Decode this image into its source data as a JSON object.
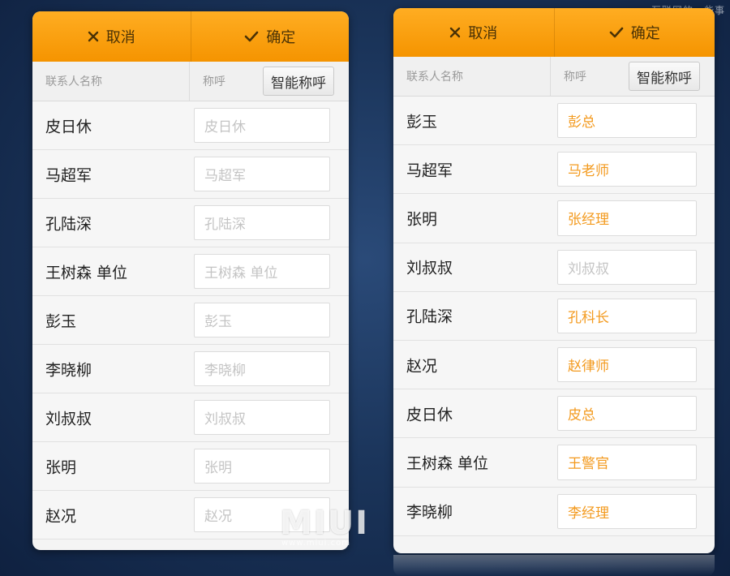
{
  "watermark": "互联网的一些事",
  "logo": {
    "text": "MIUI",
    "url": "www.miui.com"
  },
  "left": {
    "cancel_label": "取消",
    "ok_label": "确定",
    "col_name": "联系人名称",
    "col_title": "称呼",
    "smart_label": "智能称呼",
    "rows": [
      {
        "name": "皮日休",
        "title": "",
        "placeholder": "皮日休"
      },
      {
        "name": "马超军",
        "title": "",
        "placeholder": "马超军"
      },
      {
        "name": "孔陆深",
        "title": "",
        "placeholder": "孔陆深"
      },
      {
        "name": "王树森 单位",
        "title": "",
        "placeholder": "王树森 单位"
      },
      {
        "name": "彭玉",
        "title": "",
        "placeholder": "彭玉"
      },
      {
        "name": "李晓柳",
        "title": "",
        "placeholder": "李晓柳"
      },
      {
        "name": "刘叔叔",
        "title": "",
        "placeholder": "刘叔叔"
      },
      {
        "name": "张明",
        "title": "",
        "placeholder": "张明"
      },
      {
        "name": "赵况",
        "title": "",
        "placeholder": "赵况"
      }
    ]
  },
  "right": {
    "cancel_label": "取消",
    "ok_label": "确定",
    "col_name": "联系人名称",
    "col_title": "称呼",
    "smart_label": "智能称呼",
    "rows": [
      {
        "name": "彭玉",
        "title": "彭总",
        "placeholder": "彭玉"
      },
      {
        "name": "马超军",
        "title": "马老师",
        "placeholder": "马超军"
      },
      {
        "name": "张明",
        "title": "张经理",
        "placeholder": "张明"
      },
      {
        "name": "刘叔叔",
        "title": "",
        "placeholder": "刘叔叔"
      },
      {
        "name": "孔陆深",
        "title": "孔科长",
        "placeholder": "孔陆深"
      },
      {
        "name": "赵况",
        "title": "赵律师",
        "placeholder": "赵况"
      },
      {
        "name": "皮日休",
        "title": "皮总",
        "placeholder": "皮日休"
      },
      {
        "name": "王树森 单位",
        "title": "王警官",
        "placeholder": "王树森 单位"
      },
      {
        "name": "李晓柳",
        "title": "李经理",
        "placeholder": "李晓柳"
      }
    ]
  },
  "colors": {
    "accent": "#f59400",
    "title_set": "#f39a1e",
    "placeholder": "#c4c4c4"
  }
}
